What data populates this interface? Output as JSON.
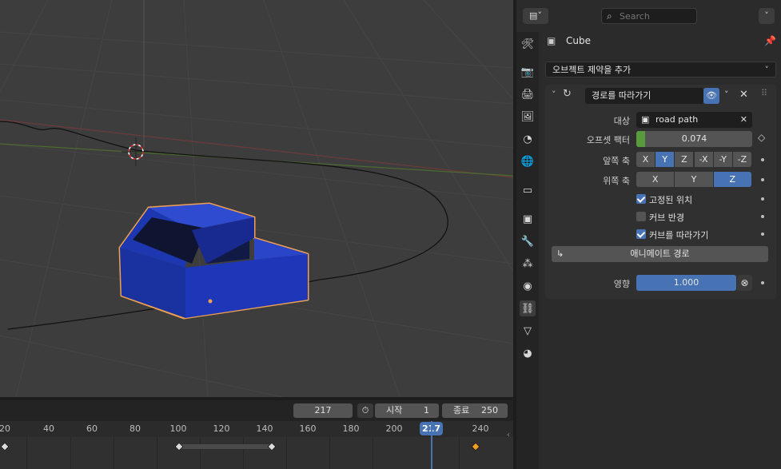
{
  "colors": {
    "accent": "#4772b3",
    "offset_fill": "#5a9a3e",
    "selection_outline": "#f0a050",
    "car_body": "#1d37b0",
    "playhead": "#4772b3",
    "active_keyframe": "#f0a020"
  },
  "header": {
    "editor_type_icon": "editor-type-icon",
    "search_placeholder": "Search"
  },
  "object": {
    "name": "Cube"
  },
  "add_constraint_label": "오브젝트 제약을 추가",
  "constraint": {
    "name": "경로를 따라가기",
    "target_label": "대상",
    "target_value": "road path",
    "offset_label": "오프셋 팩터",
    "offset_value": "0.074",
    "offset_fraction": 0.074,
    "forward_label": "앞쪽 축",
    "forward_axes": [
      "X",
      "Y",
      "Z",
      "-X",
      "-Y",
      "-Z"
    ],
    "forward_selected": "Y",
    "up_label": "위쪽 축",
    "up_axes": [
      "X",
      "Y",
      "Z"
    ],
    "up_selected": "Z",
    "fixed_position_label": "고정된 위치",
    "fixed_position": true,
    "curve_radius_label": "커브 반경",
    "curve_radius": false,
    "follow_curve_label": "커브를 따라가기",
    "follow_curve": true,
    "animate_path_label": "애니메이트 경로",
    "influence_label": "영향",
    "influence_value": "1.000",
    "influence_fraction": 1.0
  },
  "timeline": {
    "current_frame": "217",
    "start_label": "시작",
    "start_value": "1",
    "end_label": "종료",
    "end_value": "250",
    "ruler_ticks": [
      "20",
      "40",
      "60",
      "80",
      "100",
      "120",
      "140",
      "160",
      "180",
      "200",
      "240"
    ],
    "playhead_label": "217"
  },
  "tabs": [
    {
      "name": "tool-tab-icon",
      "glyph": "🛠"
    },
    {
      "name": "render-tab-icon",
      "glyph": "📷"
    },
    {
      "name": "output-tab-icon",
      "glyph": "🖨"
    },
    {
      "name": "view-layer-tab-icon",
      "glyph": "🖼"
    },
    {
      "name": "scene-tab-icon",
      "glyph": "◔"
    },
    {
      "name": "world-tab-icon",
      "glyph": "🌐"
    },
    {
      "name": "collection-tab-icon",
      "glyph": "▭"
    },
    {
      "name": "object-tab-icon",
      "glyph": "▣"
    },
    {
      "name": "modifier-tab-icon",
      "glyph": "🔧"
    },
    {
      "name": "particles-tab-icon",
      "glyph": "⁂"
    },
    {
      "name": "physics-tab-icon",
      "glyph": "◉"
    },
    {
      "name": "constraints-tab-icon",
      "glyph": "⛓"
    },
    {
      "name": "data-tab-icon",
      "glyph": "▽"
    },
    {
      "name": "material-tab-icon",
      "glyph": "◕"
    }
  ]
}
